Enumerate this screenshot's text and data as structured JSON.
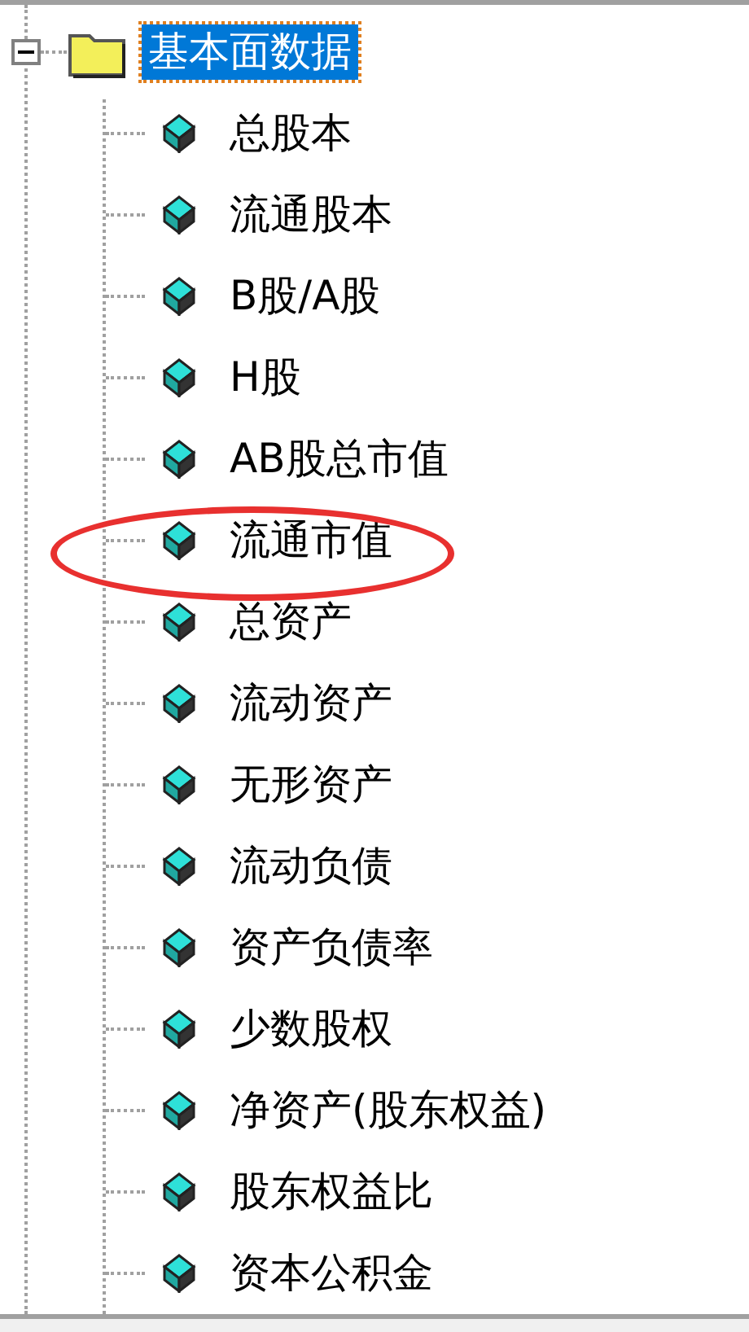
{
  "tree": {
    "label": "基本面数据",
    "expanded": true,
    "selected": true,
    "children": [
      {
        "label": "总股本",
        "selected": false,
        "highlighted": false
      },
      {
        "label": "流通股本",
        "selected": false,
        "highlighted": false
      },
      {
        "label": "B股/A股",
        "selected": false,
        "highlighted": false
      },
      {
        "label": "H股",
        "selected": false,
        "highlighted": false
      },
      {
        "label": "AB股总市值",
        "selected": false,
        "highlighted": false
      },
      {
        "label": "流通市值",
        "selected": false,
        "highlighted": true
      },
      {
        "label": "总资产",
        "selected": false,
        "highlighted": false
      },
      {
        "label": "流动资产",
        "selected": false,
        "highlighted": false
      },
      {
        "label": "无形资产",
        "selected": false,
        "highlighted": false
      },
      {
        "label": "流动负债",
        "selected": false,
        "highlighted": false
      },
      {
        "label": "资产负债率",
        "selected": false,
        "highlighted": false
      },
      {
        "label": "少数股权",
        "selected": false,
        "highlighted": false
      },
      {
        "label": "净资产(股东权益)",
        "selected": false,
        "highlighted": false
      },
      {
        "label": "股东权益比",
        "selected": false,
        "highlighted": false
      },
      {
        "label": "资本公积金",
        "selected": false,
        "highlighted": false
      }
    ]
  }
}
